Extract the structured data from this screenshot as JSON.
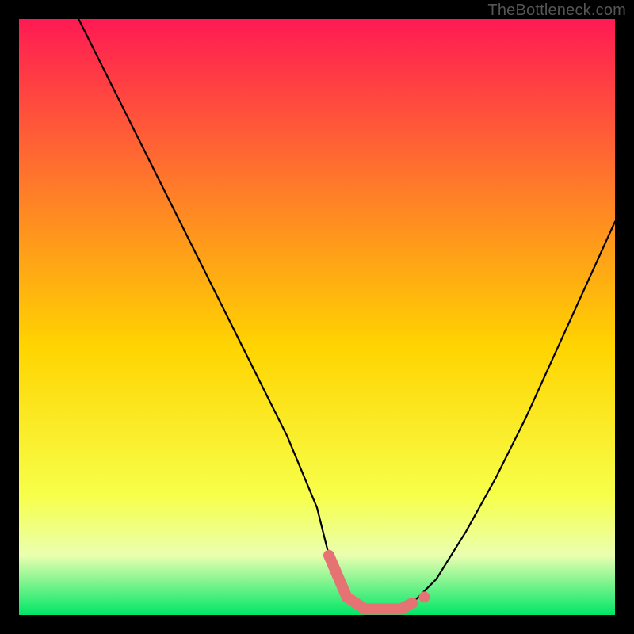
{
  "watermark": "TheBottleneck.com",
  "colors": {
    "gradient_top": "#ff1a53",
    "gradient_mid_upper": "#ff7a2a",
    "gradient_mid": "#ffd400",
    "gradient_low": "#f7ff4a",
    "gradient_pale": "#eaffb0",
    "gradient_bottom": "#00e667",
    "curve": "#000000",
    "accent": "#e57373",
    "frame": "#000000"
  },
  "chart_data": {
    "type": "line",
    "title": "",
    "xlabel": "",
    "ylabel": "",
    "xlim": [
      0,
      100
    ],
    "ylim": [
      0,
      100
    ],
    "series": [
      {
        "name": "bottleneck-curve",
        "x": [
          10,
          15,
          20,
          25,
          30,
          35,
          40,
          45,
          50,
          52,
          55,
          58,
          60,
          62,
          64,
          66,
          70,
          75,
          80,
          85,
          90,
          95,
          100
        ],
        "y": [
          100,
          90,
          80,
          70,
          60,
          50,
          40,
          30,
          18,
          10,
          3,
          1,
          1,
          1,
          1,
          2,
          6,
          14,
          23,
          33,
          44,
          55,
          66
        ]
      }
    ],
    "accent_segment": {
      "name": "optimal-range",
      "x": [
        52,
        55,
        58,
        60,
        62,
        64,
        66
      ],
      "y": [
        10,
        3,
        1,
        1,
        1,
        1,
        2
      ]
    },
    "accent_dot": {
      "x": 68,
      "y": 3
    }
  }
}
